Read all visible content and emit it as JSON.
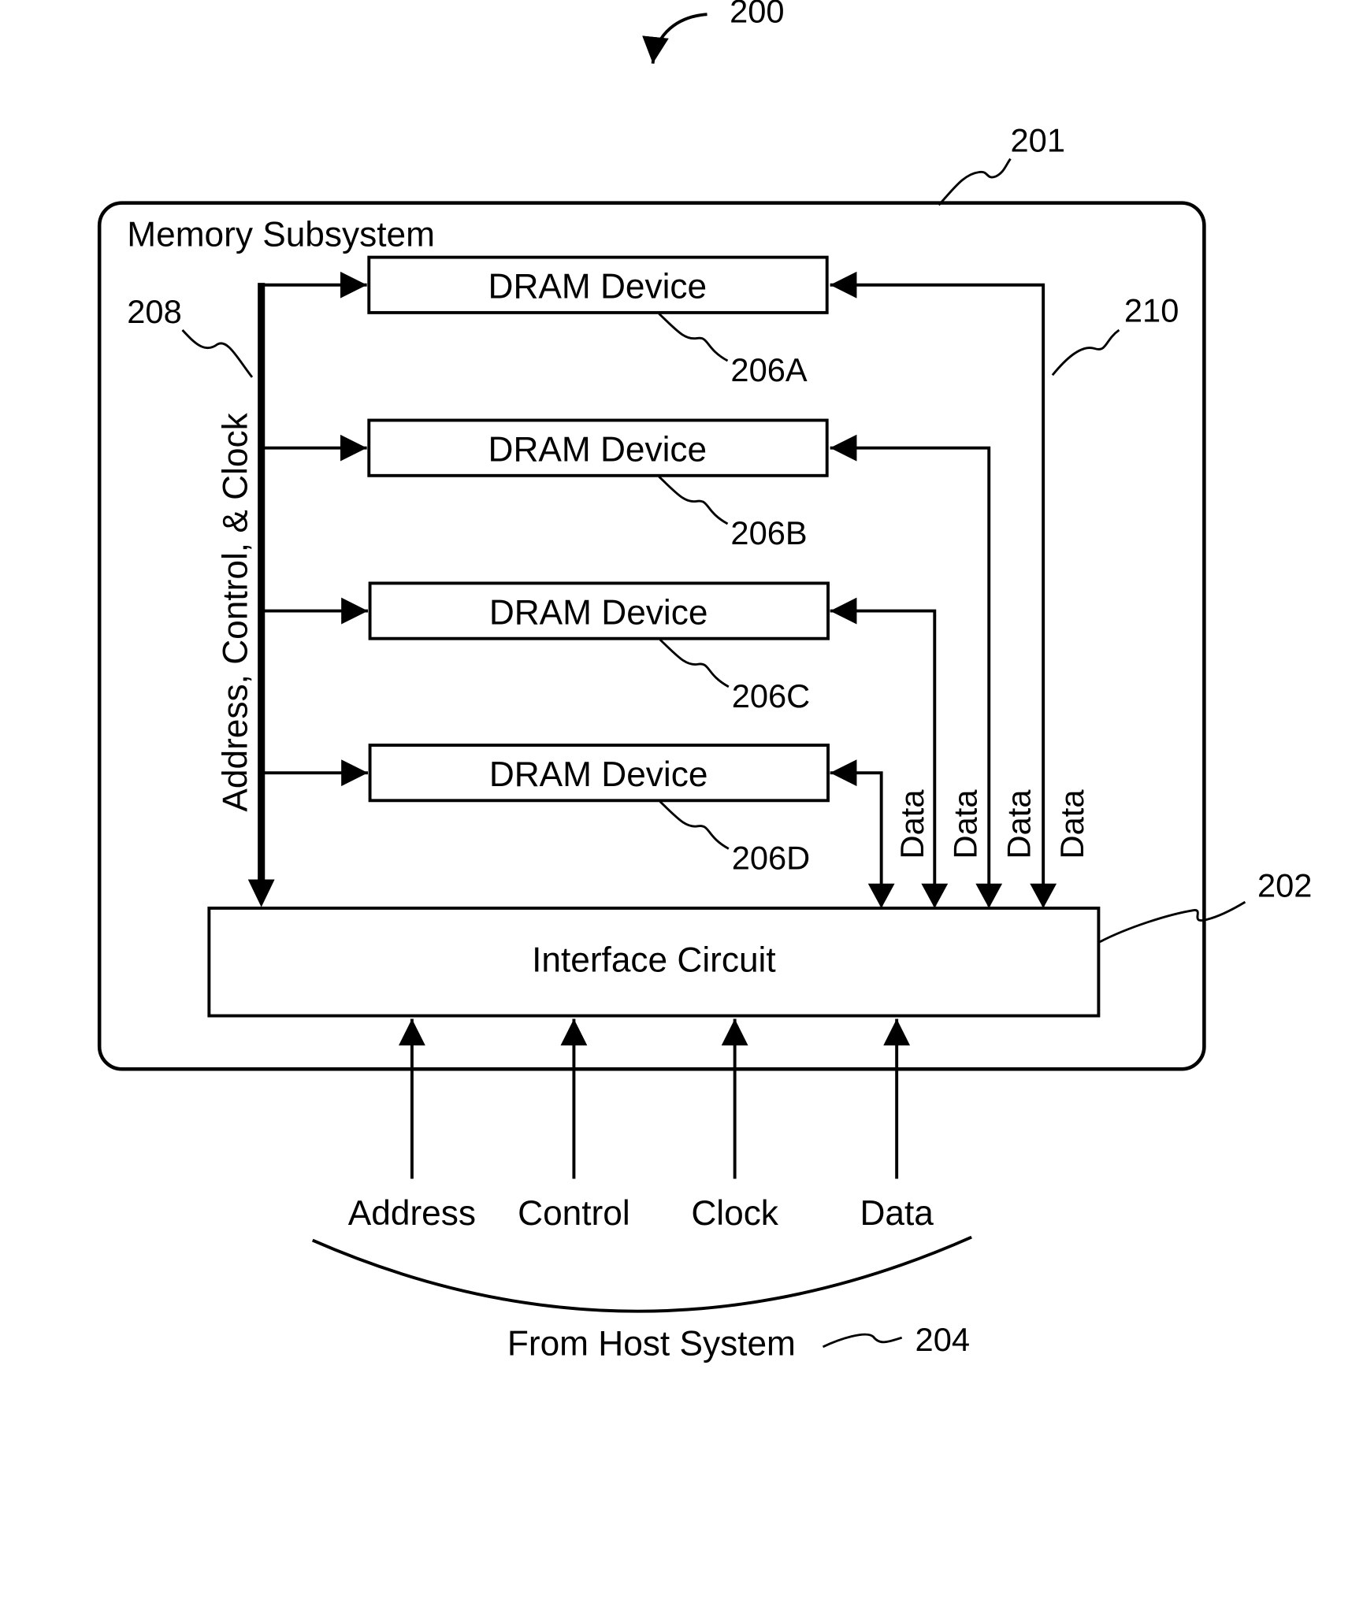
{
  "figure": {
    "ref_number": "200",
    "subsystem": {
      "label": "Memory Subsystem",
      "ref": "201"
    },
    "bus": {
      "label": "Address, Control, & Clock",
      "ref": "208"
    },
    "data_bus_ref": "210",
    "dram_devices": [
      {
        "label": "DRAM Device",
        "ref": "206A"
      },
      {
        "label": "DRAM Device",
        "ref": "206B"
      },
      {
        "label": "DRAM Device",
        "ref": "206C"
      },
      {
        "label": "DRAM Device",
        "ref": "206D"
      }
    ],
    "data_labels": [
      "Data",
      "Data",
      "Data",
      "Data"
    ],
    "interface": {
      "label": "Interface Circuit",
      "ref": "202"
    },
    "host_signals": [
      "Address",
      "Control",
      "Clock",
      "Data"
    ],
    "host": {
      "label": "From Host System",
      "ref": "204"
    }
  }
}
